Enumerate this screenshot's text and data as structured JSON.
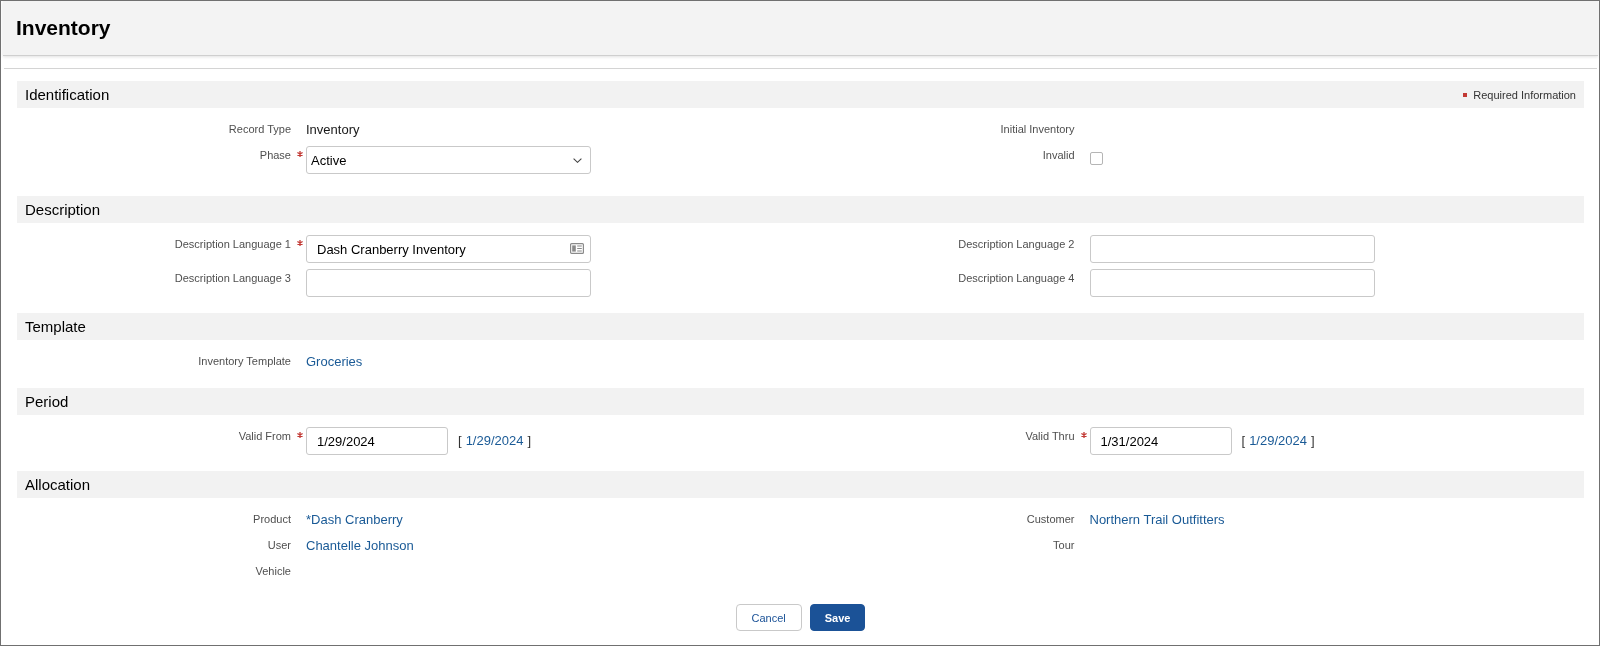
{
  "header": {
    "title": "Inventory"
  },
  "sections": [
    {
      "title": "Identification",
      "note": "Required Information",
      "rows": [
        {
          "left": {
            "label": "Record Type",
            "required": false,
            "kind": "text",
            "value": "Inventory"
          },
          "right": {
            "label": "Initial Inventory",
            "required": false,
            "kind": "text"
          }
        },
        {
          "left": {
            "label": "Phase",
            "required": true,
            "kind": "select",
            "value": "Active"
          },
          "right": {
            "label": "Invalid",
            "required": false,
            "kind": "checkbox",
            "checked": false
          }
        }
      ]
    },
    {
      "title": "Description",
      "rows": [
        {
          "left": {
            "label": "Description Language 1",
            "required": true,
            "kind": "lookup",
            "value": "Dash Cranberry Inventory"
          },
          "right": {
            "label": "Description Language 2",
            "required": false,
            "kind": "textbox"
          }
        },
        {
          "left": {
            "label": "Description Language 3",
            "required": false,
            "kind": "textbox"
          },
          "right": {
            "label": "Description Language 4",
            "required": false,
            "kind": "textbox"
          }
        }
      ]
    },
    {
      "title": "Template",
      "rows": [
        {
          "left": {
            "label": "Inventory Template",
            "required": false,
            "kind": "link",
            "value": "Groceries"
          }
        }
      ]
    },
    {
      "title": "Period",
      "rows": [
        {
          "left": {
            "label": "Valid From",
            "required": true,
            "kind": "date",
            "value": "1/29/2024",
            "bracket_open": "[",
            "link": "1/29/2024",
            "bracket_close": "]"
          },
          "right": {
            "label": "Valid Thru",
            "required": true,
            "kind": "date",
            "value": "1/31/2024",
            "bracket_open": "[",
            "link": "1/29/2024",
            "bracket_close": "]"
          }
        }
      ]
    },
    {
      "title": "Allocation",
      "rows": [
        {
          "left": {
            "label": "Product",
            "required": false,
            "kind": "link",
            "value": "*Dash Cranberry"
          },
          "right": {
            "label": "Customer",
            "required": false,
            "kind": "link",
            "value": "Northern Trail Outfitters"
          }
        },
        {
          "left": {
            "label": "User",
            "required": false,
            "kind": "link",
            "value": "Chantelle Johnson"
          },
          "right": {
            "label": "Tour",
            "required": false,
            "kind": "text"
          }
        },
        {
          "left": {
            "label": "Vehicle",
            "required": false,
            "kind": "text"
          }
        }
      ]
    }
  ],
  "buttons": [
    {
      "label": "Cancel",
      "kind": "secondary"
    },
    {
      "label": "Save",
      "kind": "primary"
    }
  ]
}
